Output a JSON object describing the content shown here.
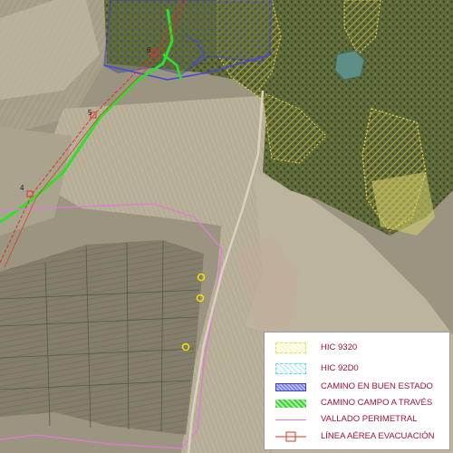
{
  "map": {
    "accent_colors": {
      "hic_9320": "#e8d84a",
      "hic_92d0": "#6bd6e6",
      "camino_buen_estado": "#3b3fcf",
      "camino_campo_traves": "#3ed33a",
      "vallado_perimetral": "#e27ad6",
      "linea_aerea_evacuacion": "#e0302a"
    },
    "point_labels": [
      "4",
      "5",
      "6"
    ]
  },
  "legend": {
    "items": [
      {
        "label": "HIC 9320",
        "swatch": "hic9320"
      },
      {
        "label": "HIC 92D0",
        "swatch": "hic92d0"
      },
      {
        "label": "CAMINO EN BUEN ESTADO",
        "swatch": "camino-bueno"
      },
      {
        "label": "CAMINO CAMPO A TRAVÉS",
        "swatch": "campo"
      },
      {
        "label": "VALLADO PERIMETRAL",
        "swatch": "vallado"
      },
      {
        "label": "LÍNEA AÉREA EVACUACIÓN",
        "swatch": "linea"
      }
    ]
  }
}
